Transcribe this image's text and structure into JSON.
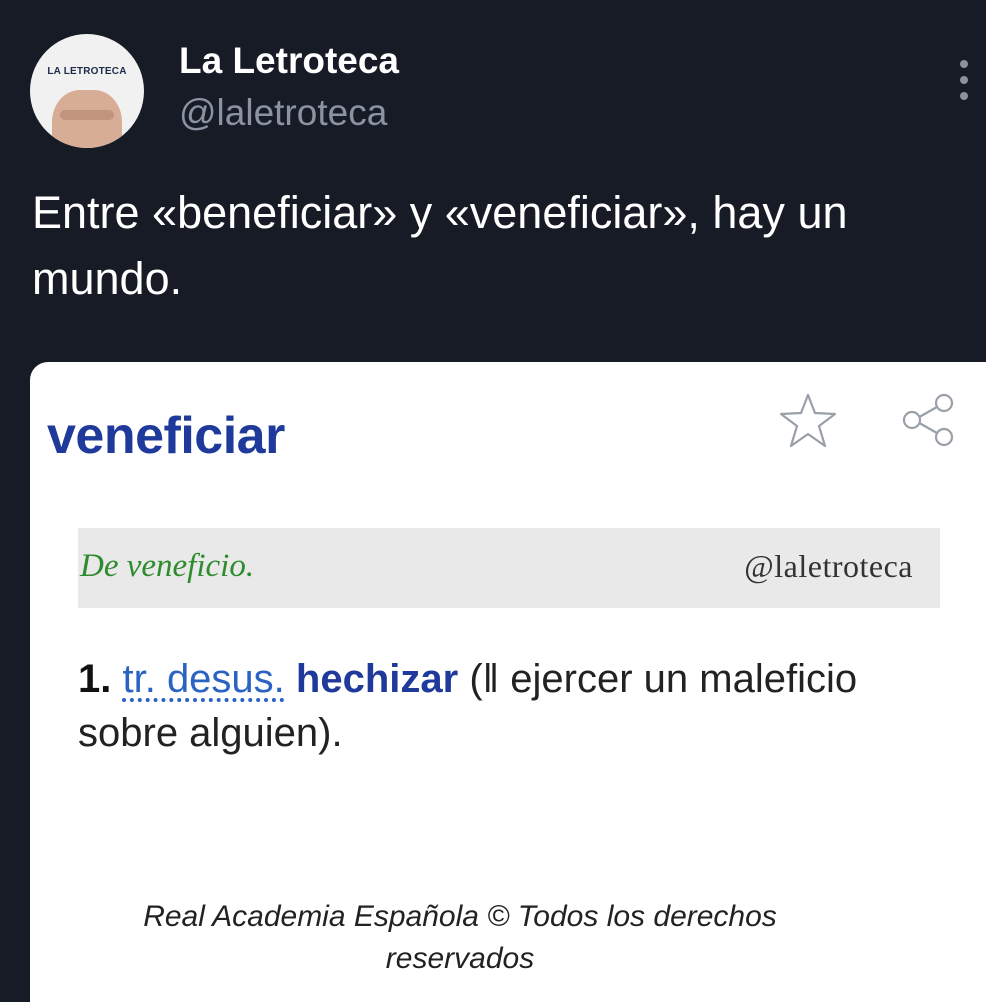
{
  "author": {
    "display_name": "La Letroteca",
    "handle": "@laletroteca",
    "avatar_logo_text": "LA LETROTECA"
  },
  "tweet": {
    "text": "Entre «beneficiar» y «veneficiar», hay un mundo."
  },
  "dictionary_card": {
    "word": "veneficiar",
    "etymology": "De veneficio.",
    "watermark": "@laletroteca",
    "definition": {
      "number": "1.",
      "abbreviations": "tr. desus.",
      "headword_link": "hechizar",
      "text": "(‖ ejercer un maleficio sobre alguien)."
    },
    "footer": "Real Academia Española © Todos los derechos reservados",
    "icons": [
      "star-icon",
      "share-icon"
    ]
  },
  "colors": {
    "background": "#161b26",
    "word": "#1f3a9a",
    "etymology": "#2e8b2e",
    "abbreviation_link": "#2a63c2",
    "muted_text": "#8b93a2"
  }
}
